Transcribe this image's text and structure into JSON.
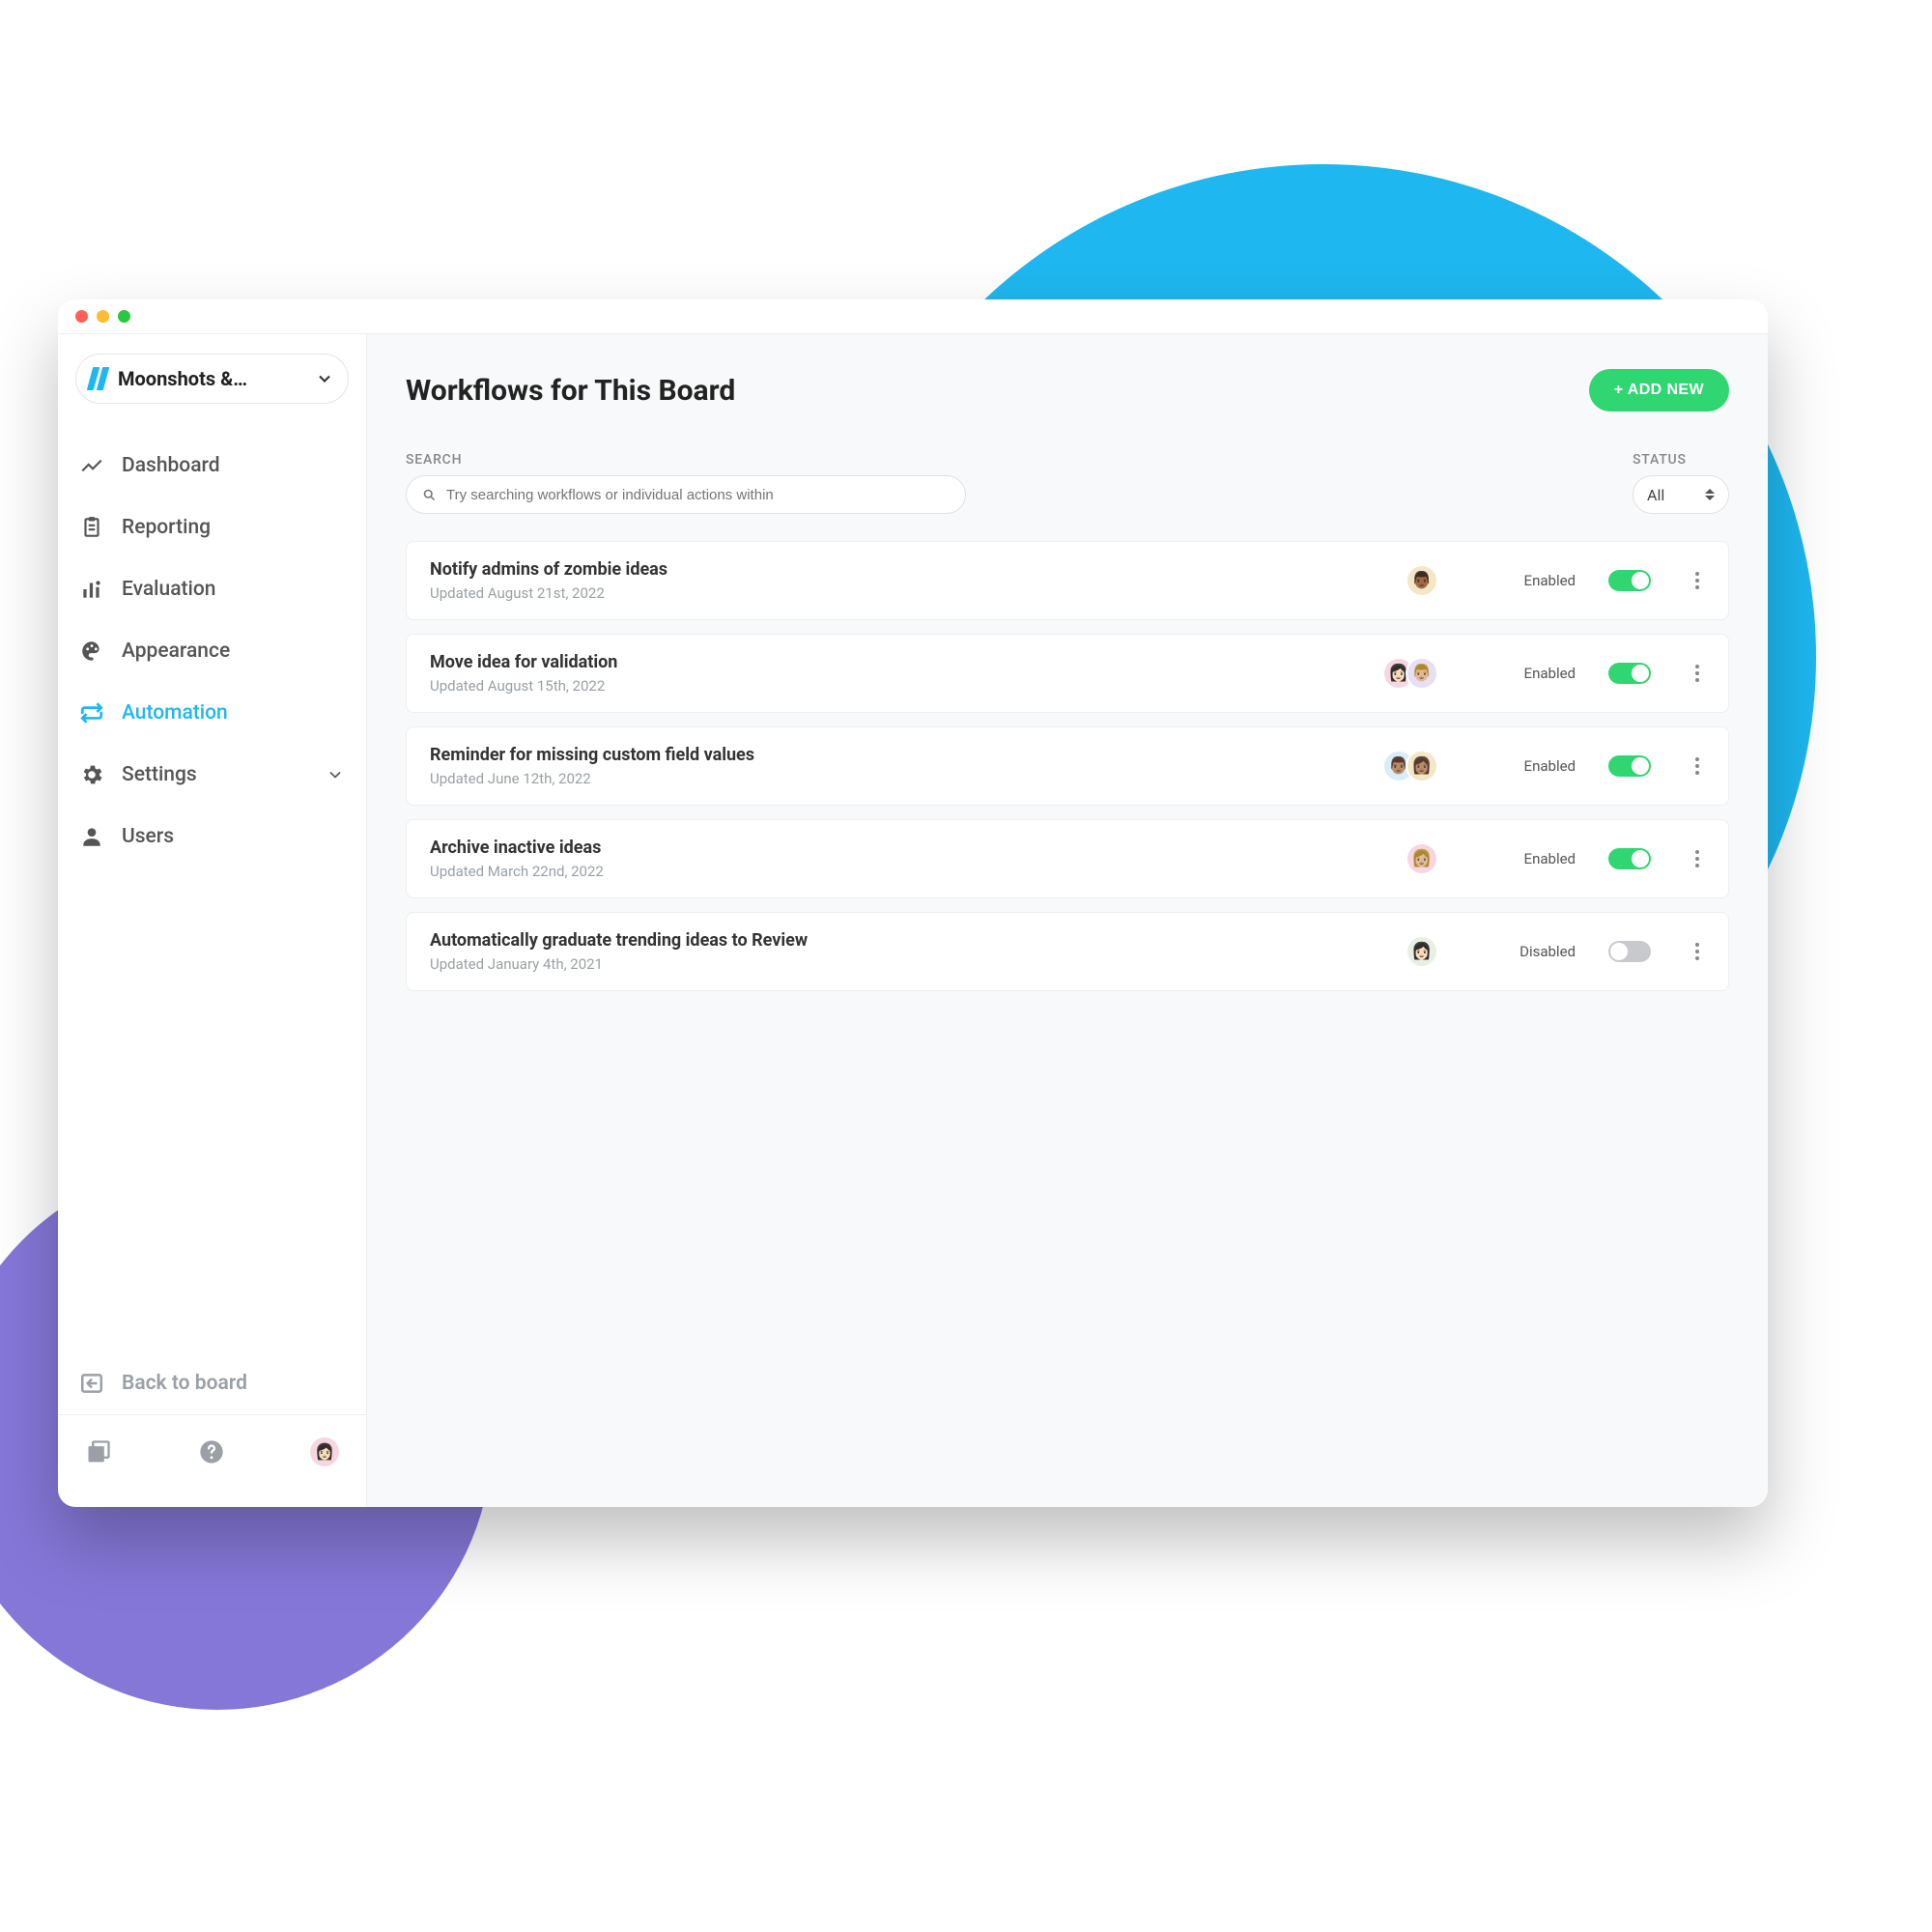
{
  "sidebar": {
    "board_name": "Moonshots &…",
    "items": [
      {
        "label": "Dashboard"
      },
      {
        "label": "Reporting"
      },
      {
        "label": "Evaluation"
      },
      {
        "label": "Appearance"
      },
      {
        "label": "Automation"
      },
      {
        "label": "Settings",
        "expandable": true
      },
      {
        "label": "Users"
      }
    ],
    "back_label": "Back to board"
  },
  "header": {
    "title": "Workflows for This Board",
    "add_button": "+ ADD NEW"
  },
  "filters": {
    "search_label": "SEARCH",
    "search_placeholder": "Try searching workflows or individual actions within",
    "status_label": "STATUS",
    "status_value": "All"
  },
  "workflows": [
    {
      "title": "Notify admins of zombie ideas",
      "updated": "Updated August 21st, 2022",
      "status": "Enabled",
      "on": true,
      "avatars": [
        {
          "bg": "#F4E7C8",
          "e": "👨🏾"
        }
      ]
    },
    {
      "title": "Move idea for validation",
      "updated": "Updated August 15th, 2022",
      "status": "Enabled",
      "on": true,
      "avatars": [
        {
          "bg": "#F7D6DF",
          "e": "👩🏻"
        },
        {
          "bg": "#E8DFF5",
          "e": "👨🏼"
        }
      ]
    },
    {
      "title": "Reminder for missing custom field values",
      "updated": "Updated June 12th, 2022",
      "status": "Enabled",
      "on": true,
      "avatars": [
        {
          "bg": "#D6EEF7",
          "e": "👨🏽"
        },
        {
          "bg": "#F4E7C8",
          "e": "👩🏽"
        }
      ]
    },
    {
      "title": "Archive inactive ideas",
      "updated": "Updated March 22nd, 2022",
      "status": "Enabled",
      "on": true,
      "avatars": [
        {
          "bg": "#F7D6DF",
          "e": "👩🏼"
        }
      ]
    },
    {
      "title": "Automatically graduate trending ideas to Review",
      "updated": "Updated January 4th, 2021",
      "status": "Disabled",
      "on": false,
      "avatars": [
        {
          "bg": "#E8F0E4",
          "e": "👩🏻"
        }
      ]
    }
  ]
}
